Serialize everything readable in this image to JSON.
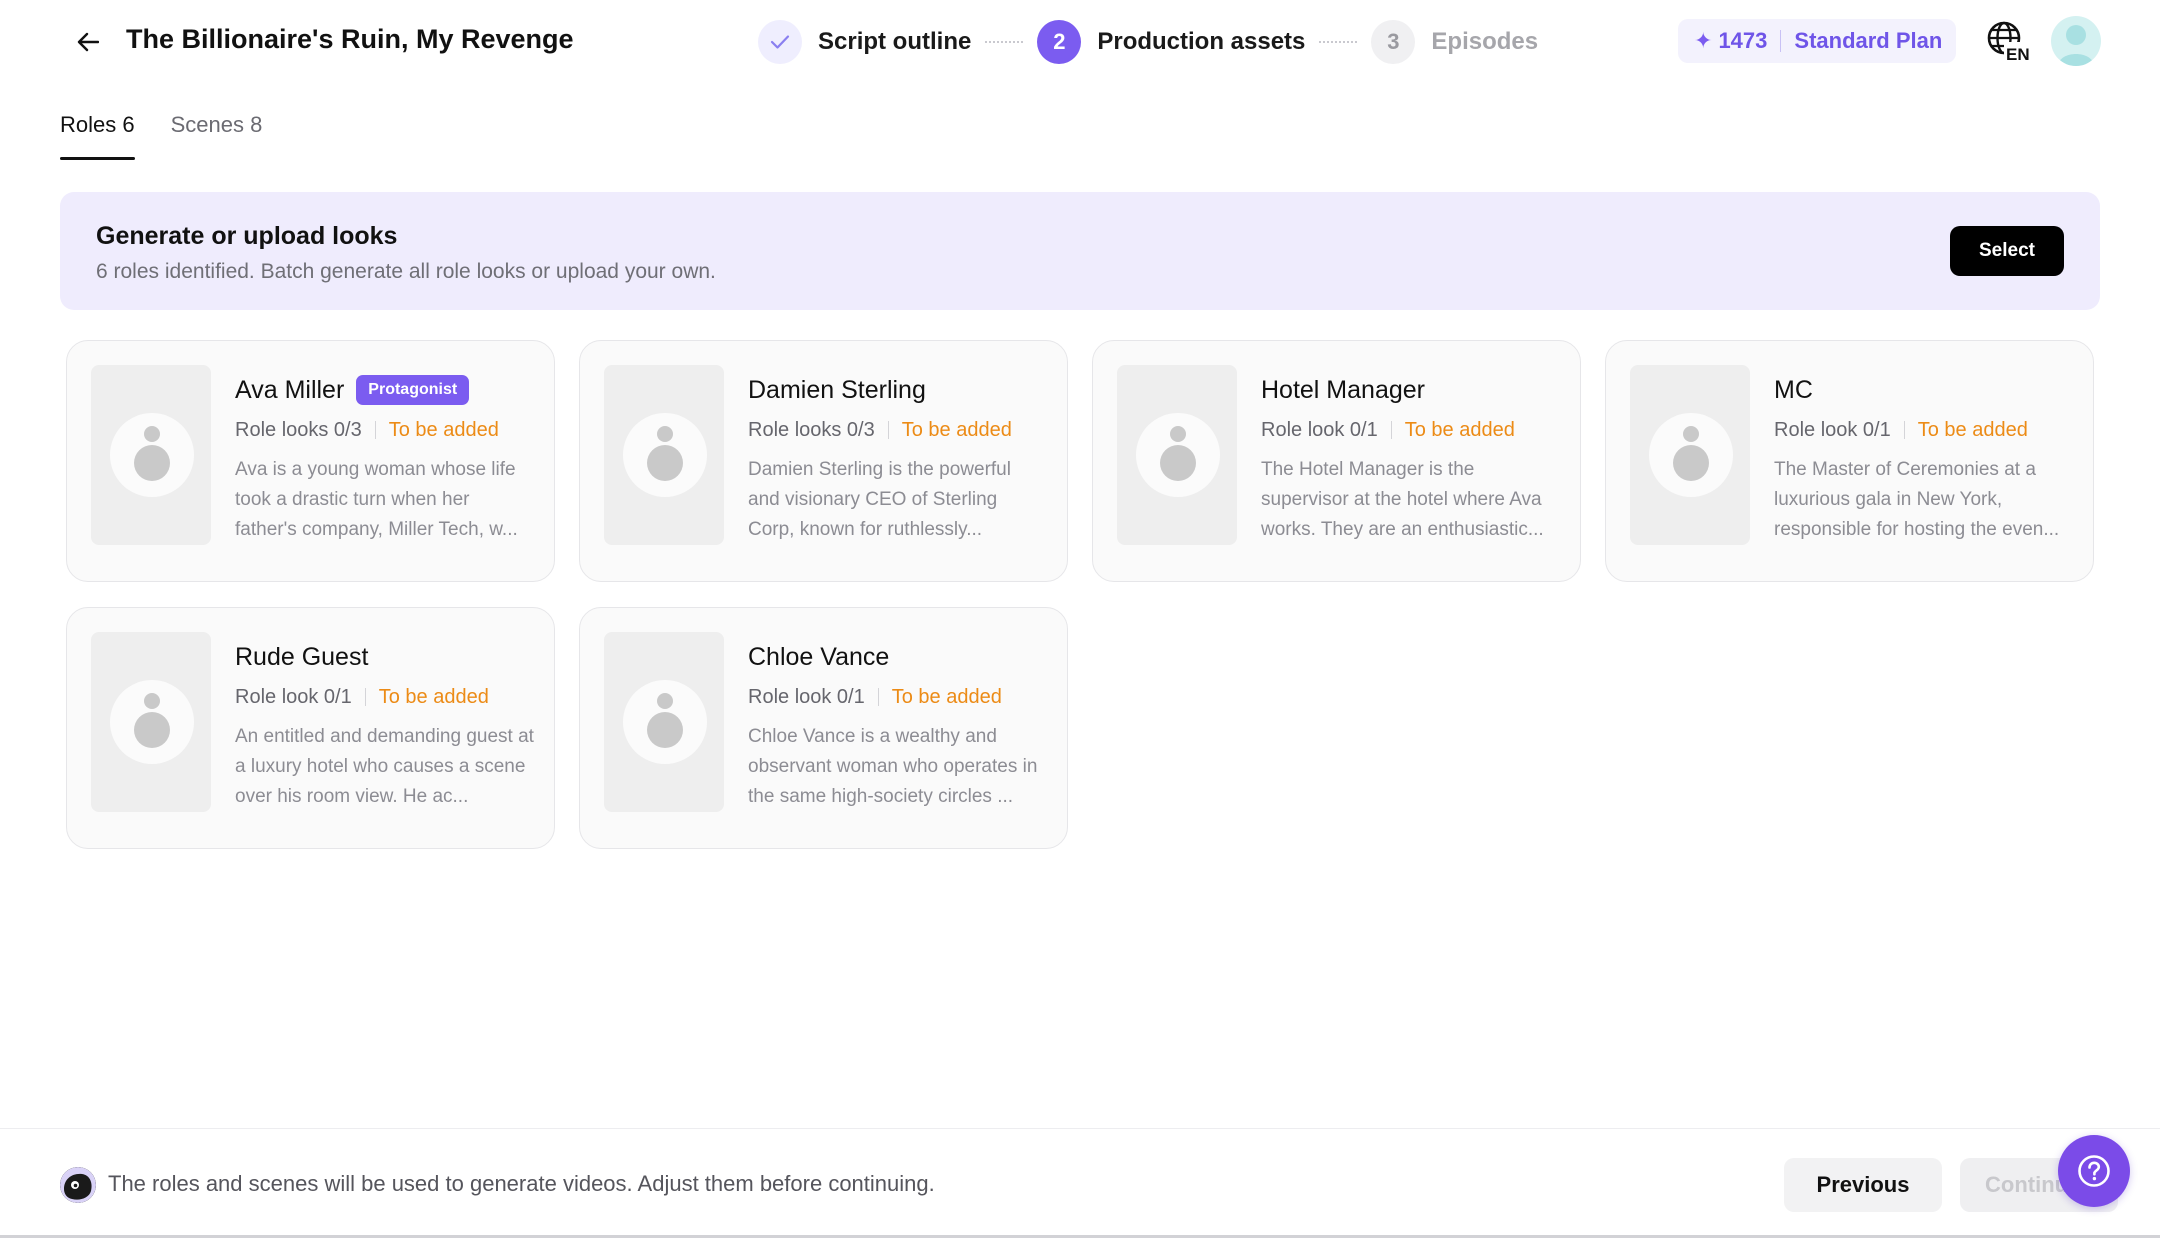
{
  "header": {
    "title": "The Billionaire's Ruin, My Revenge",
    "steps": [
      {
        "number": "1",
        "label": "Script outline",
        "state": "done"
      },
      {
        "number": "2",
        "label": "Production assets",
        "state": "active"
      },
      {
        "number": "3",
        "label": "Episodes",
        "state": "pending"
      }
    ],
    "credits": "1473",
    "plan": "Standard Plan",
    "language": "EN",
    "icons": {
      "back": "arrow-left-icon",
      "credits": "sparkle-icon",
      "language": "globe-icon",
      "done": "check-icon"
    }
  },
  "tabs": [
    {
      "label": "Roles 6",
      "active": true
    },
    {
      "label": "Scenes 8",
      "active": false
    }
  ],
  "banner": {
    "title": "Generate or upload looks",
    "subtitle": "6 roles identified. Batch generate all role looks or upload your own.",
    "button": "Select"
  },
  "roles": [
    {
      "name": "Ava Miller",
      "badge": "Protagonist",
      "count": "Role looks 0/3",
      "status": "To be added",
      "description": "Ava is a young woman whose life took a drastic turn when her father's company, Miller Tech, w..."
    },
    {
      "name": "Damien Sterling",
      "badge": "",
      "count": "Role looks 0/3",
      "status": "To be added",
      "description": "Damien Sterling is the powerful and visionary CEO of Sterling Corp, known for ruthlessly..."
    },
    {
      "name": "Hotel Manager",
      "badge": "",
      "count": "Role look 0/1",
      "status": "To be added",
      "description": "The Hotel Manager is the supervisor at the hotel where Ava works. They are an enthusiastic..."
    },
    {
      "name": "MC",
      "badge": "",
      "count": "Role look 0/1",
      "status": "To be added",
      "description": "The Master of Ceremonies at a luxurious gala in New York, responsible for hosting the even..."
    },
    {
      "name": "Rude Guest",
      "badge": "",
      "count": "Role look 0/1",
      "status": "To be added",
      "description": "An entitled and demanding guest at a luxury hotel who causes a scene over his room view. He ac..."
    },
    {
      "name": "Chloe Vance",
      "badge": "",
      "count": "Role look 0/1",
      "status": "To be added",
      "description": "Chloe Vance is a wealthy and observant woman who operates in the same high-society circles ..."
    }
  ],
  "footer": {
    "hint": "The roles and scenes will be used to generate videos. Adjust them before continuing.",
    "previous": "Previous",
    "continue": "Continue"
  },
  "colors": {
    "accent": "#7b5cf0",
    "status_pending": "#ec8b16",
    "banner_bg": "#efecfd",
    "help_button": "#7b4be8"
  }
}
